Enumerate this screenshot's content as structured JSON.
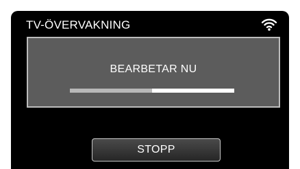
{
  "screen": {
    "title": "TV-ÖVERVAKNING",
    "status_icon": "wifi-icon",
    "status_icon_color": "#ffffff"
  },
  "panel": {
    "message": "BEARBETAR NU",
    "progress_fraction": 0.5,
    "progress_done_color": "#b8b8b8",
    "progress_remaining_color": "#ffffff"
  },
  "controls": {
    "stop_label": "STOPP"
  }
}
